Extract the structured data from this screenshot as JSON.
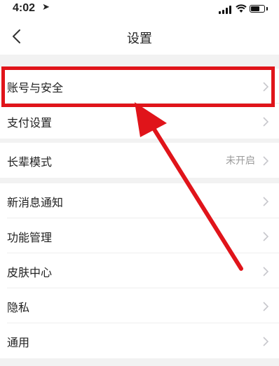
{
  "status_bar": {
    "time": "4:02",
    "location_glyph": "➤"
  },
  "nav": {
    "title": "设置",
    "back_icon": "chevron-left-icon"
  },
  "groups": [
    {
      "items": [
        {
          "label": "账号与安全",
          "value": ""
        },
        {
          "label": "支付设置",
          "value": ""
        }
      ]
    },
    {
      "items": [
        {
          "label": "长辈模式",
          "value": "未开启"
        }
      ]
    },
    {
      "items": [
        {
          "label": "新消息通知",
          "value": ""
        },
        {
          "label": "功能管理",
          "value": ""
        },
        {
          "label": "皮肤中心",
          "value": ""
        },
        {
          "label": "隐私",
          "value": ""
        },
        {
          "label": "通用",
          "value": ""
        }
      ]
    }
  ],
  "colors": {
    "annotation_red": "#e0141a",
    "background": "#f2f2f2",
    "secondary_text": "#9b9b9b"
  }
}
